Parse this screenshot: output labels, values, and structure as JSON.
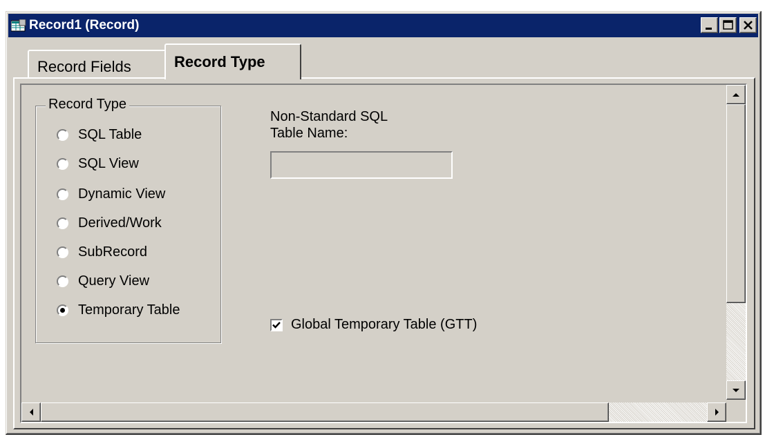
{
  "window": {
    "title": "Record1 (Record)",
    "controls": [
      "minimize-icon",
      "maximize-icon",
      "close-icon"
    ]
  },
  "tabs": [
    {
      "label": "Record Fields",
      "active": false
    },
    {
      "label": "Record Type",
      "active": true
    }
  ],
  "record_type_group": {
    "label": "Record Type",
    "options": [
      {
        "label": "SQL Table",
        "checked": false
      },
      {
        "label": "SQL View",
        "checked": false
      },
      {
        "label": "Dynamic View",
        "checked": false
      },
      {
        "label": "Derived/Work",
        "checked": false
      },
      {
        "label": "SubRecord",
        "checked": false
      },
      {
        "label": "Query View",
        "checked": false
      },
      {
        "label": "Temporary Table",
        "checked": true
      }
    ]
  },
  "non_standard_sql": {
    "label_line1": "Non-Standard SQL",
    "label_line2": "Table Name:",
    "value": ""
  },
  "gtt_checkbox": {
    "label": "Global Temporary Table (GTT)",
    "checked": true
  },
  "colors": {
    "titlebar": "#0a246a",
    "face": "#d4d0c8"
  }
}
